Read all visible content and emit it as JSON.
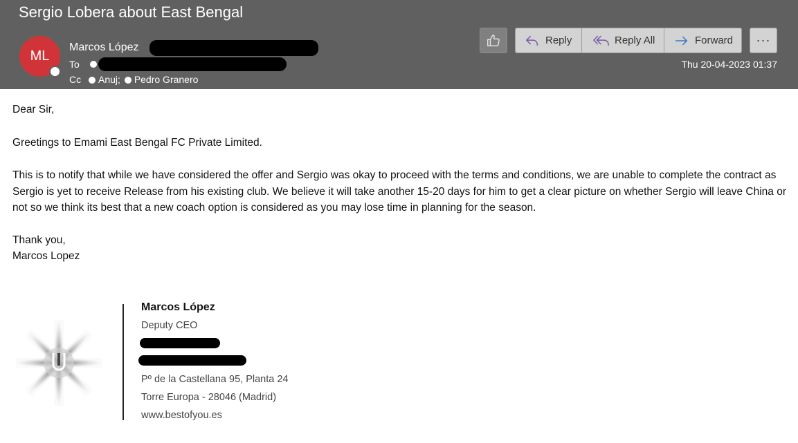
{
  "email": {
    "subject": "Sergio Lobera about East Bengal",
    "sender": {
      "initials": "ML",
      "name": "Marcos López",
      "avatar_color": "#d13438"
    },
    "to_label": "To",
    "cc_label": "Cc",
    "cc": [
      "Anuj;",
      "Pedro Granero"
    ],
    "date": "Thu 20-04-2023 01:37"
  },
  "toolbar": {
    "like_icon": "thumbs-up-icon",
    "reply_label": "Reply",
    "reply_all_label": "Reply All",
    "forward_label": "Forward",
    "more_label": "···"
  },
  "body": {
    "greeting": "Dear Sir,",
    "intro": "Greetings to Emami East Bengal FC Private Limited.",
    "main": "This is to notify that while we have considered the offer and Sergio was okay to proceed with the terms and conditions, we are unable to complete the contract as Sergio is yet to receive Release from his existing club. We believe it will take another 15-20 days for him to get a clear picture on whether Sergio will leave China or not so we think its best that a new coach option is considered as you may lose time in planning for the season.",
    "closing": "Thank you,",
    "signoff": "Marcos Lopez"
  },
  "signature": {
    "name": "Marcos López",
    "title": "Deputy CEO",
    "address_line1": "Pº de la Castellana 95, Planta 24",
    "address_line2": "Torre Europa - 28046 (Madrid)",
    "website": "www.bestofyou.es"
  },
  "colors": {
    "header_bg": "#606060",
    "button_bg": "#d3d3d3",
    "icon_accent": "#7a5aa6",
    "forward_accent": "#3b74c4"
  }
}
